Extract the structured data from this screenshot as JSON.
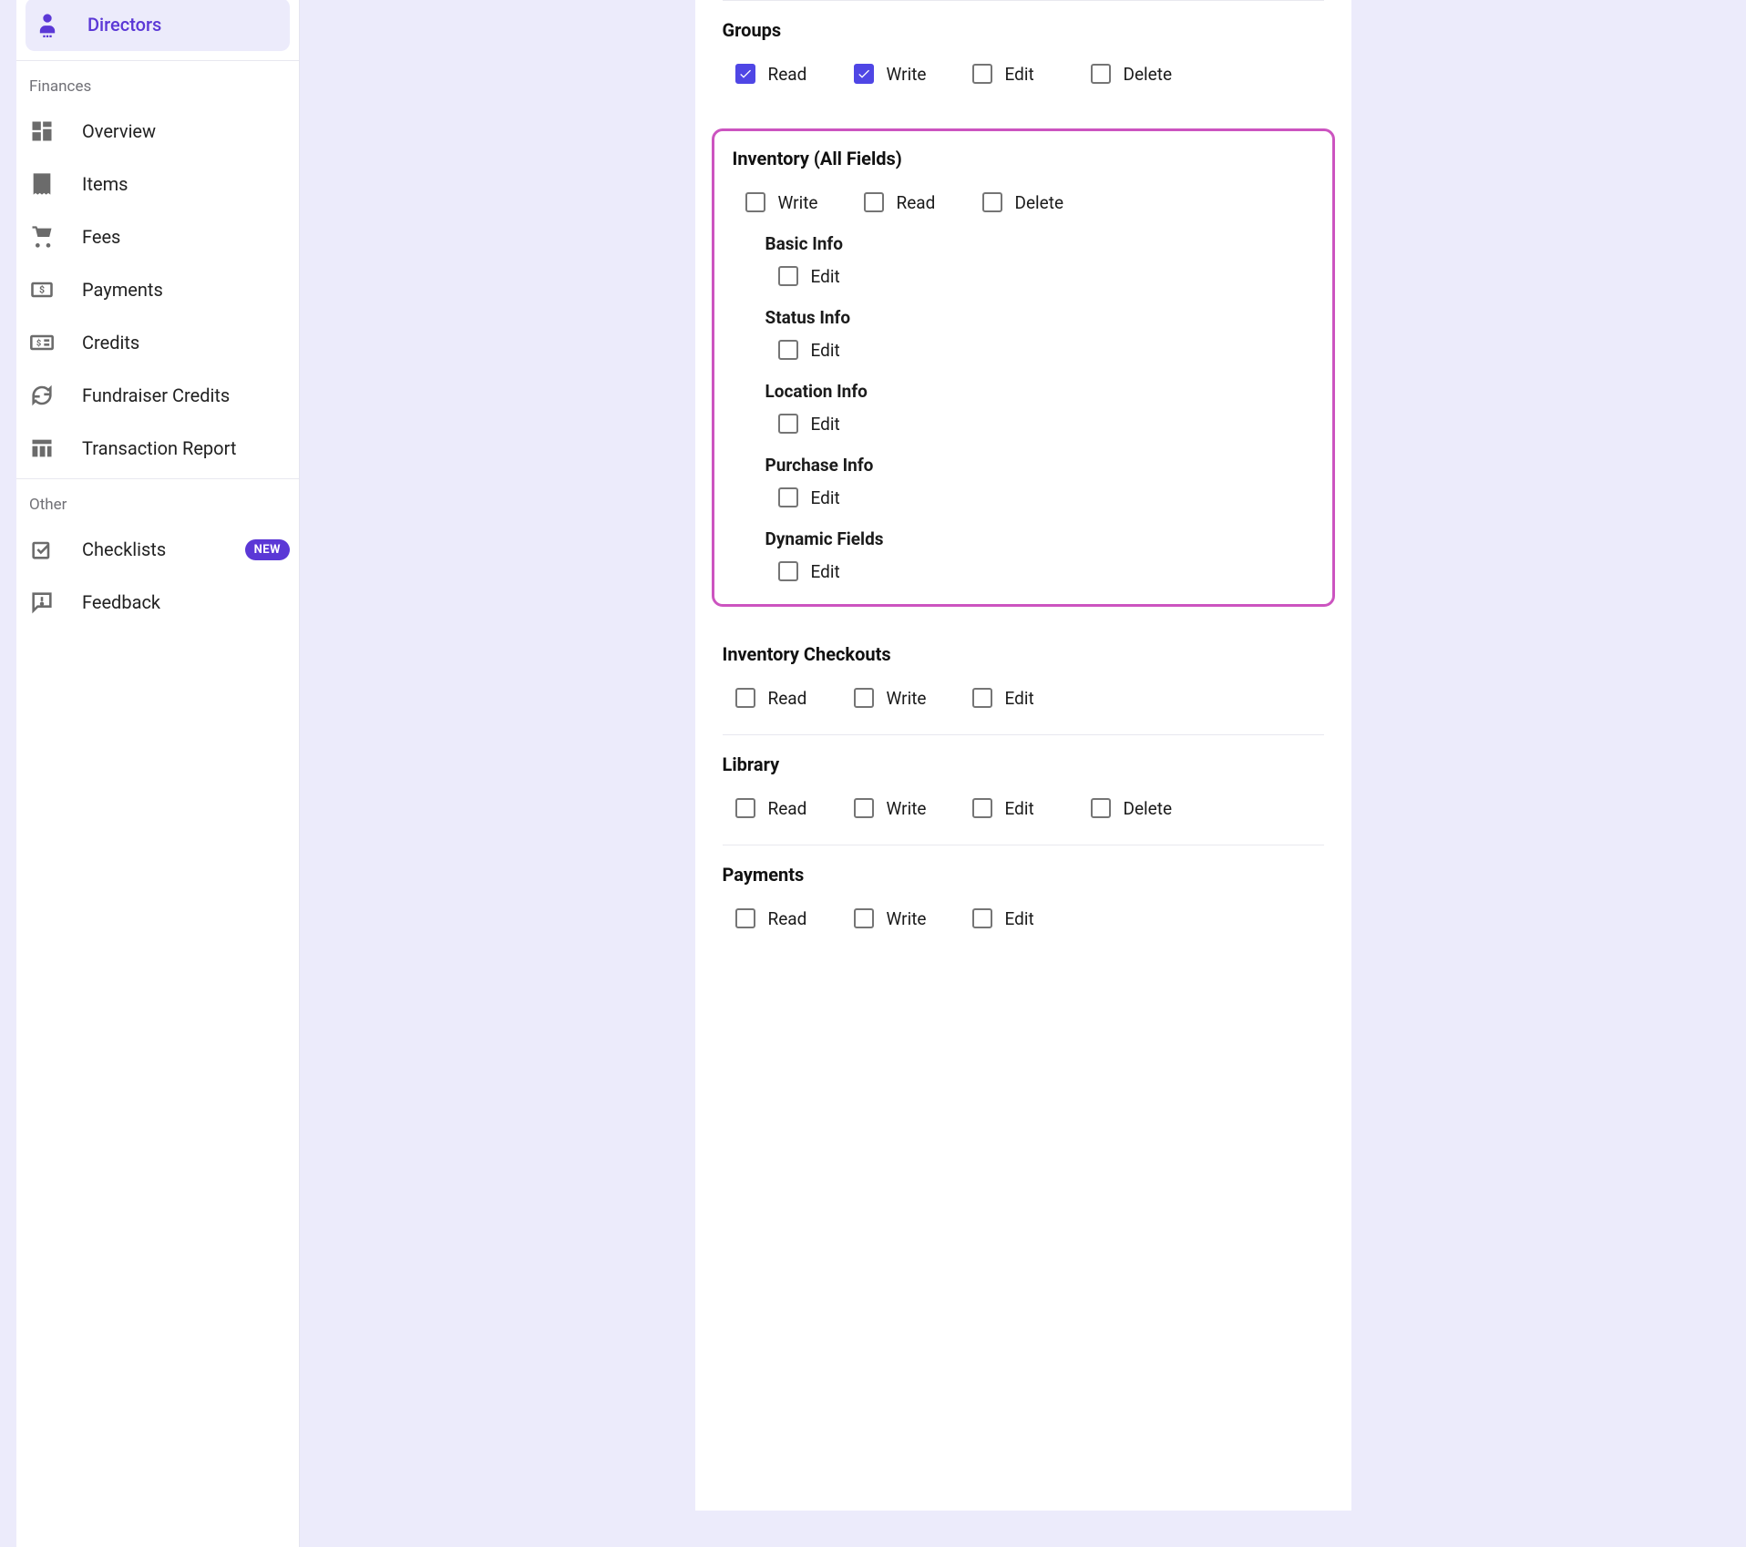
{
  "sidebar": {
    "active_item": {
      "label": "Directors"
    },
    "finances": {
      "header": "Finances",
      "items": [
        {
          "label": "Overview"
        },
        {
          "label": "Items"
        },
        {
          "label": "Fees"
        },
        {
          "label": "Payments"
        },
        {
          "label": "Credits"
        },
        {
          "label": "Fundraiser Credits"
        },
        {
          "label": "Transaction Report"
        }
      ]
    },
    "other": {
      "header": "Other",
      "items": [
        {
          "label": "Checklists",
          "badge": "NEW"
        },
        {
          "label": "Feedback"
        }
      ]
    }
  },
  "permissions": {
    "groups": {
      "title": "Groups",
      "options": [
        {
          "label": "Read",
          "checked": true
        },
        {
          "label": "Write",
          "checked": true
        },
        {
          "label": "Edit",
          "checked": false
        },
        {
          "label": "Delete",
          "checked": false
        }
      ]
    },
    "inventory": {
      "title": "Inventory (All Fields)",
      "options": [
        {
          "label": "Write",
          "checked": false
        },
        {
          "label": "Read",
          "checked": false
        },
        {
          "label": "Delete",
          "checked": false
        }
      ],
      "sub": [
        {
          "title": "Basic Info",
          "options": [
            {
              "label": "Edit",
              "checked": false
            }
          ]
        },
        {
          "title": "Status Info",
          "options": [
            {
              "label": "Edit",
              "checked": false
            }
          ]
        },
        {
          "title": "Location Info",
          "options": [
            {
              "label": "Edit",
              "checked": false
            }
          ]
        },
        {
          "title": "Purchase Info",
          "options": [
            {
              "label": "Edit",
              "checked": false
            }
          ]
        },
        {
          "title": "Dynamic Fields",
          "options": [
            {
              "label": "Edit",
              "checked": false
            }
          ]
        }
      ]
    },
    "inventory_checkouts": {
      "title": "Inventory Checkouts",
      "options": [
        {
          "label": "Read",
          "checked": false
        },
        {
          "label": "Write",
          "checked": false
        },
        {
          "label": "Edit",
          "checked": false
        }
      ]
    },
    "library": {
      "title": "Library",
      "options": [
        {
          "label": "Read",
          "checked": false
        },
        {
          "label": "Write",
          "checked": false
        },
        {
          "label": "Edit",
          "checked": false
        },
        {
          "label": "Delete",
          "checked": false
        }
      ]
    },
    "payments": {
      "title": "Payments",
      "options": [
        {
          "label": "Read",
          "checked": false
        },
        {
          "label": "Write",
          "checked": false
        },
        {
          "label": "Edit",
          "checked": false
        }
      ]
    }
  }
}
